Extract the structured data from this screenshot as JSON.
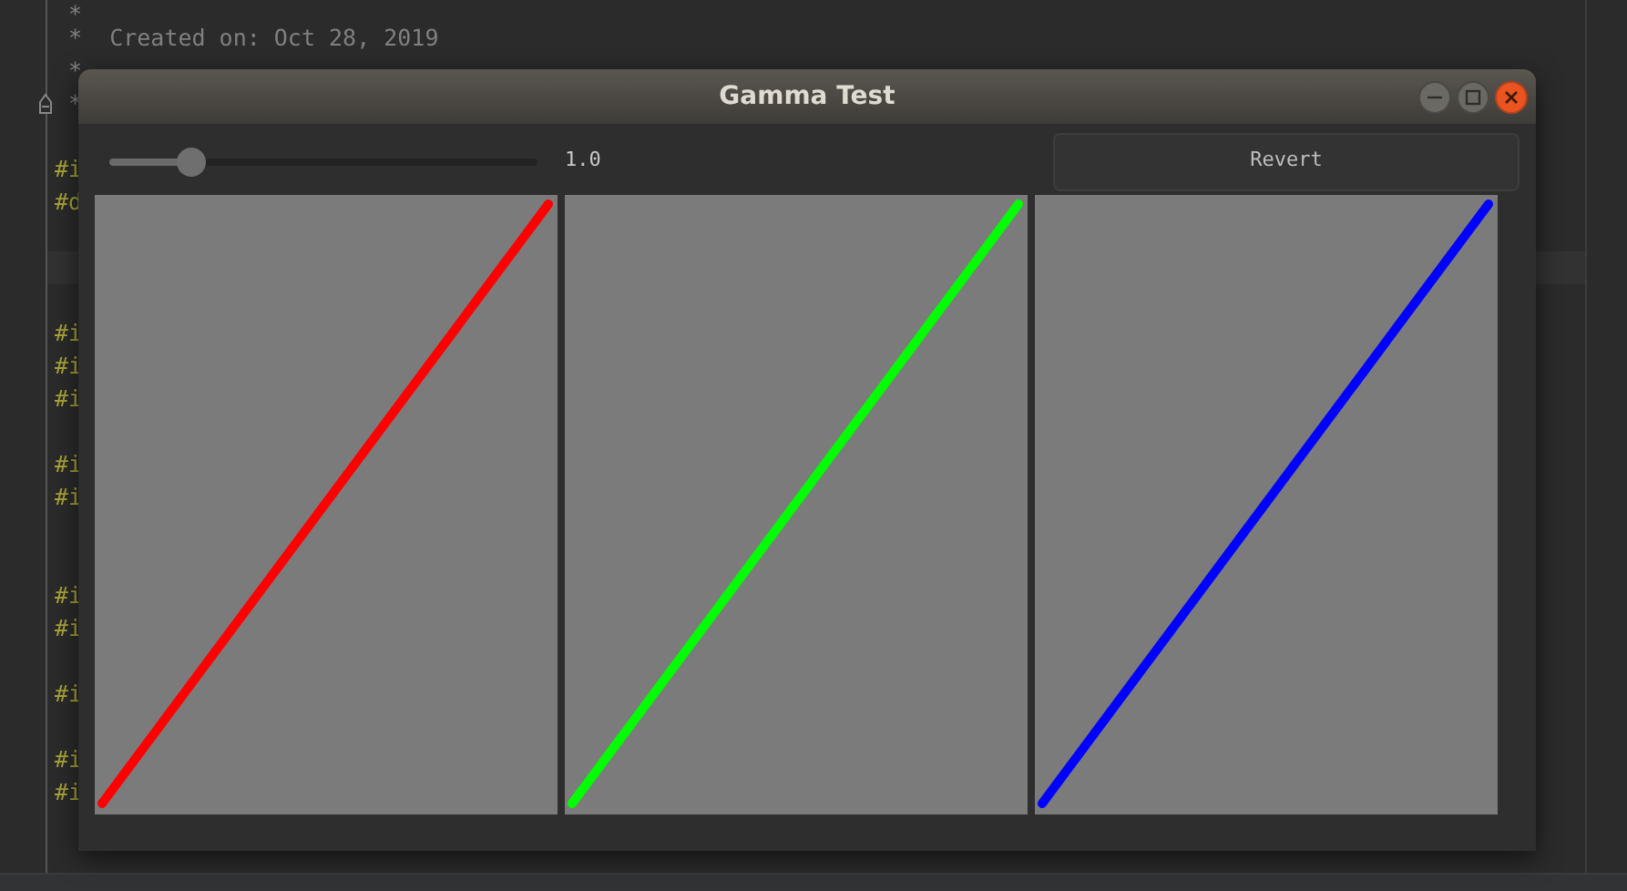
{
  "editor": {
    "lines": [
      {
        "text": " *",
        "kind": "comment"
      },
      {
        "text": " *  Created on: Oct 28, 2019",
        "kind": "comment"
      },
      {
        "text": " *",
        "kind": "comment"
      },
      {
        "text": " *",
        "kind": "comment"
      },
      {
        "text": "#i",
        "kind": "directive"
      },
      {
        "text": "#d",
        "kind": "directive"
      },
      {
        "text": "#i",
        "kind": "directive"
      },
      {
        "text": "#i",
        "kind": "directive"
      },
      {
        "text": "#i",
        "kind": "directive"
      },
      {
        "text": "#i",
        "kind": "directive"
      },
      {
        "text": "#i",
        "kind": "directive"
      },
      {
        "text": "#i",
        "kind": "directive"
      },
      {
        "text": "#i",
        "kind": "directive"
      },
      {
        "text": "#i",
        "kind": "directive"
      },
      {
        "text": "#i",
        "kind": "directive"
      },
      {
        "text": "#i",
        "kind": "directive"
      }
    ]
  },
  "window": {
    "title": "Gamma Test",
    "slider": {
      "level": 0.19,
      "reading": "1.0"
    },
    "revert_button": "Revert",
    "plots": [
      {
        "color": "#ff0000"
      },
      {
        "color": "#00ff00"
      },
      {
        "color": "#0000ff"
      }
    ]
  }
}
